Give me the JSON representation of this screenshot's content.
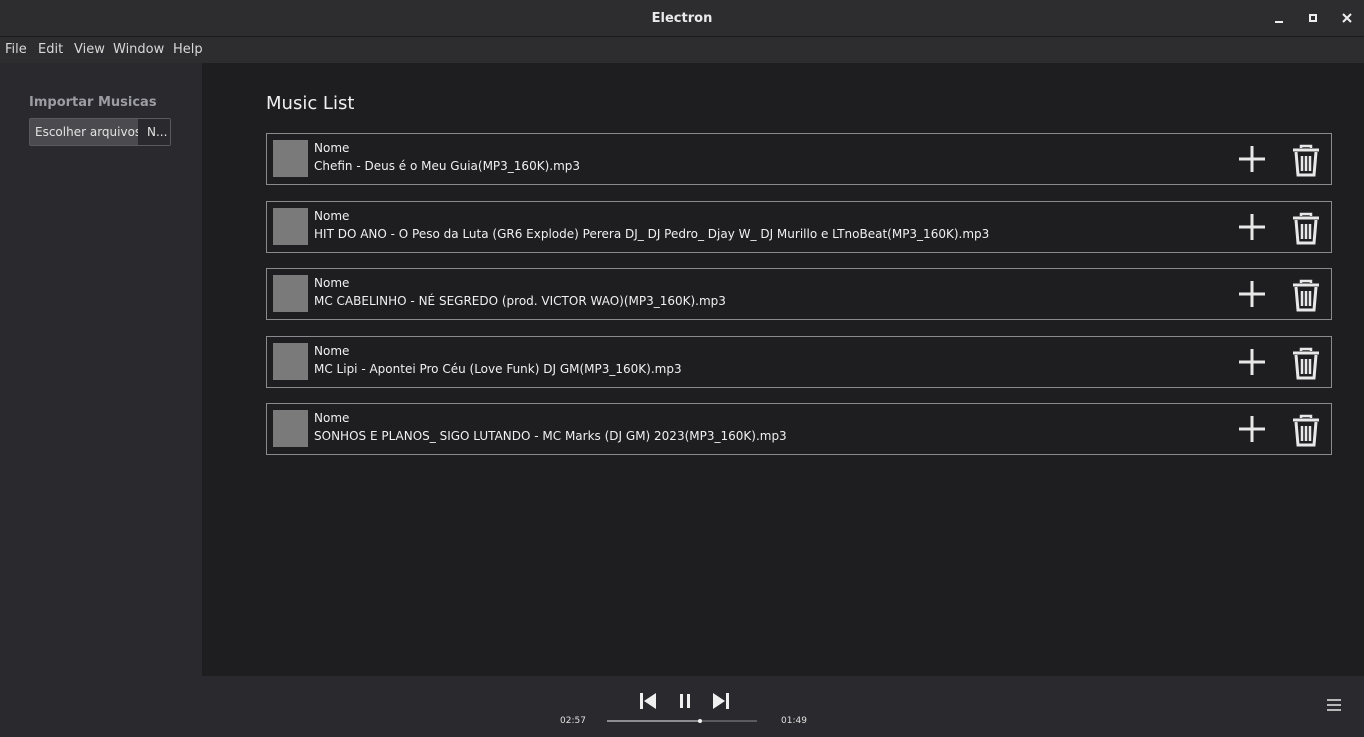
{
  "window": {
    "title": "Electron",
    "minimize_icon": "minimize-icon",
    "maximize_icon": "maximize-icon",
    "close_icon": "close-icon"
  },
  "menu": {
    "items": [
      "File",
      "Edit",
      "View",
      "Window",
      "Help"
    ]
  },
  "sidebar": {
    "heading": "Importar Musicas",
    "file_button_label": "Escolher arquivos",
    "file_status": "N..."
  },
  "main": {
    "title": "Music List",
    "songs": [
      {
        "label": "Nome",
        "file": "Chefin - Deus é o Meu Guia(MP3_160K).mp3"
      },
      {
        "label": "Nome",
        "file": "HIT DO ANO - O Peso da Luta (GR6 Explode) Perera DJ_ DJ Pedro_ Djay W_ DJ Murillo e LTnoBeat(MP3_160K).mp3"
      },
      {
        "label": "Nome",
        "file": "MC CABELINHO - NÉ SEGREDO (prod. VICTOR WAO)(MP3_160K).mp3"
      },
      {
        "label": "Nome",
        "file": "MC Lipi - Apontei Pro Céu (Love Funk) DJ GM(MP3_160K).mp3"
      },
      {
        "label": "Nome",
        "file": "SONHOS E PLANOS_ SIGO LUTANDO - MC Marks (DJ GM) 2023(MP3_160K).mp3"
      }
    ]
  },
  "player": {
    "elapsed": "02:57",
    "remaining": "01:49",
    "progress_fraction": 0.62,
    "icons": [
      "previous-icon",
      "pause-icon",
      "next-icon",
      "menu-icon"
    ]
  },
  "colors": {
    "background": "#1e1e21",
    "sidebar": "#2a292d",
    "titlebar": "#2d2d2f",
    "row_border": "#8a8a8e",
    "thumb": "#7a7a7a"
  }
}
